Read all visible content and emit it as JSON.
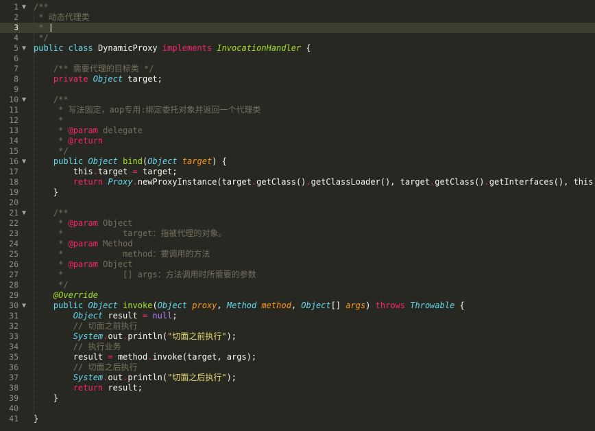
{
  "editor": {
    "current_line": 3,
    "lines": [
      {
        "n": "1",
        "fold": true,
        "tokens": [
          {
            "t": "/**",
            "c": "comment"
          }
        ]
      },
      {
        "n": "2",
        "fold": false,
        "tokens": [
          {
            "t": " * 动态代理类",
            "c": "comment"
          }
        ]
      },
      {
        "n": "3",
        "fold": false,
        "tokens": [
          {
            "t": " * ",
            "c": "comment"
          },
          {
            "t": "|",
            "c": "caret"
          }
        ]
      },
      {
        "n": "4",
        "fold": false,
        "tokens": [
          {
            "t": " */",
            "c": "comment"
          }
        ]
      },
      {
        "n": "5",
        "fold": true,
        "tokens": [
          {
            "t": "public",
            "c": "storage"
          },
          {
            "t": " ",
            "c": "plain"
          },
          {
            "t": "class",
            "c": "storage"
          },
          {
            "t": " DynamicProxy ",
            "c": "plain"
          },
          {
            "t": "implements",
            "c": "keyword"
          },
          {
            "t": " ",
            "c": "plain"
          },
          {
            "t": "InvocationHandler",
            "c": "class"
          },
          {
            "t": " {",
            "c": "plain"
          }
        ]
      },
      {
        "n": "6",
        "fold": false,
        "tokens": []
      },
      {
        "n": "7",
        "fold": false,
        "tokens": [
          {
            "t": "    /** 需要代理的目标类 */",
            "c": "comment"
          }
        ]
      },
      {
        "n": "8",
        "fold": false,
        "tokens": [
          {
            "t": "    ",
            "c": "plain"
          },
          {
            "t": "private",
            "c": "keyword"
          },
          {
            "t": " ",
            "c": "plain"
          },
          {
            "t": "Object",
            "c": "type"
          },
          {
            "t": " target;",
            "c": "plain"
          }
        ]
      },
      {
        "n": "9",
        "fold": false,
        "tokens": []
      },
      {
        "n": "10",
        "fold": true,
        "tokens": [
          {
            "t": "    /**",
            "c": "comment"
          }
        ]
      },
      {
        "n": "11",
        "fold": false,
        "tokens": [
          {
            "t": "     * 写法固定，aop专用:绑定委托对象并返回一个代理类",
            "c": "comment"
          }
        ]
      },
      {
        "n": "12",
        "fold": false,
        "tokens": [
          {
            "t": "     *",
            "c": "comment"
          }
        ]
      },
      {
        "n": "13",
        "fold": false,
        "tokens": [
          {
            "t": "     * ",
            "c": "comment"
          },
          {
            "t": "@param",
            "c": "tag"
          },
          {
            "t": " delegate",
            "c": "comment"
          }
        ]
      },
      {
        "n": "14",
        "fold": false,
        "tokens": [
          {
            "t": "     * ",
            "c": "comment"
          },
          {
            "t": "@return",
            "c": "tag"
          }
        ]
      },
      {
        "n": "15",
        "fold": false,
        "tokens": [
          {
            "t": "     */",
            "c": "comment"
          }
        ]
      },
      {
        "n": "16",
        "fold": true,
        "tokens": [
          {
            "t": "    ",
            "c": "plain"
          },
          {
            "t": "public",
            "c": "storage"
          },
          {
            "t": " ",
            "c": "plain"
          },
          {
            "t": "Object",
            "c": "type"
          },
          {
            "t": " ",
            "c": "plain"
          },
          {
            "t": "bind",
            "c": "func"
          },
          {
            "t": "(",
            "c": "plain"
          },
          {
            "t": "Object",
            "c": "type"
          },
          {
            "t": " ",
            "c": "plain"
          },
          {
            "t": "target",
            "c": "param"
          },
          {
            "t": ") {",
            "c": "plain"
          }
        ]
      },
      {
        "n": "17",
        "fold": false,
        "tokens": [
          {
            "t": "        ",
            "c": "plain"
          },
          {
            "t": "this",
            "c": "plain"
          },
          {
            "t": ".",
            "c": "op"
          },
          {
            "t": "target ",
            "c": "plain"
          },
          {
            "t": "=",
            "c": "op"
          },
          {
            "t": " target;",
            "c": "plain"
          }
        ]
      },
      {
        "n": "18",
        "fold": false,
        "tokens": [
          {
            "t": "        ",
            "c": "plain"
          },
          {
            "t": "return",
            "c": "keyword"
          },
          {
            "t": " ",
            "c": "plain"
          },
          {
            "t": "Proxy",
            "c": "type"
          },
          {
            "t": ".",
            "c": "op"
          },
          {
            "t": "newProxyInstance(target",
            "c": "plain"
          },
          {
            "t": ".",
            "c": "op"
          },
          {
            "t": "getClass()",
            "c": "plain"
          },
          {
            "t": ".",
            "c": "op"
          },
          {
            "t": "getClassLoader(), target",
            "c": "plain"
          },
          {
            "t": ".",
            "c": "op"
          },
          {
            "t": "getClass()",
            "c": "plain"
          },
          {
            "t": ".",
            "c": "op"
          },
          {
            "t": "getInterfaces(), this);",
            "c": "plain"
          }
        ]
      },
      {
        "n": "19",
        "fold": false,
        "tokens": [
          {
            "t": "    }",
            "c": "plain"
          }
        ]
      },
      {
        "n": "20",
        "fold": false,
        "tokens": []
      },
      {
        "n": "21",
        "fold": true,
        "tokens": [
          {
            "t": "    /**",
            "c": "comment"
          }
        ]
      },
      {
        "n": "22",
        "fold": false,
        "tokens": [
          {
            "t": "     * ",
            "c": "comment"
          },
          {
            "t": "@param",
            "c": "tag"
          },
          {
            "t": " Object",
            "c": "comment"
          }
        ]
      },
      {
        "n": "23",
        "fold": false,
        "tokens": [
          {
            "t": "     *            target：指被代理的对象。",
            "c": "comment"
          }
        ]
      },
      {
        "n": "24",
        "fold": false,
        "tokens": [
          {
            "t": "     * ",
            "c": "comment"
          },
          {
            "t": "@param",
            "c": "tag"
          },
          {
            "t": " Method",
            "c": "comment"
          }
        ]
      },
      {
        "n": "25",
        "fold": false,
        "tokens": [
          {
            "t": "     *            method：要调用的方法",
            "c": "comment"
          }
        ]
      },
      {
        "n": "26",
        "fold": false,
        "tokens": [
          {
            "t": "     * ",
            "c": "comment"
          },
          {
            "t": "@param",
            "c": "tag"
          },
          {
            "t": " Object",
            "c": "comment"
          }
        ]
      },
      {
        "n": "27",
        "fold": false,
        "tokens": [
          {
            "t": "     *            [] args：方法调用时所需要的参数",
            "c": "comment"
          }
        ]
      },
      {
        "n": "28",
        "fold": false,
        "tokens": [
          {
            "t": "     */",
            "c": "comment"
          }
        ]
      },
      {
        "n": "29",
        "fold": false,
        "tokens": [
          {
            "t": "    ",
            "c": "plain"
          },
          {
            "t": "@Override",
            "c": "annot"
          }
        ]
      },
      {
        "n": "30",
        "fold": true,
        "tokens": [
          {
            "t": "    ",
            "c": "plain"
          },
          {
            "t": "public",
            "c": "storage"
          },
          {
            "t": " ",
            "c": "plain"
          },
          {
            "t": "Object",
            "c": "type"
          },
          {
            "t": " ",
            "c": "plain"
          },
          {
            "t": "invoke",
            "c": "func"
          },
          {
            "t": "(",
            "c": "plain"
          },
          {
            "t": "Object",
            "c": "type"
          },
          {
            "t": " ",
            "c": "plain"
          },
          {
            "t": "proxy",
            "c": "param"
          },
          {
            "t": ", ",
            "c": "plain"
          },
          {
            "t": "Method",
            "c": "type"
          },
          {
            "t": " ",
            "c": "plain"
          },
          {
            "t": "method",
            "c": "param"
          },
          {
            "t": ", ",
            "c": "plain"
          },
          {
            "t": "Object",
            "c": "type"
          },
          {
            "t": "[] ",
            "c": "plain"
          },
          {
            "t": "args",
            "c": "param"
          },
          {
            "t": ") ",
            "c": "plain"
          },
          {
            "t": "throws",
            "c": "keyword"
          },
          {
            "t": " ",
            "c": "plain"
          },
          {
            "t": "Throwable",
            "c": "type"
          },
          {
            "t": " {",
            "c": "plain"
          }
        ]
      },
      {
        "n": "31",
        "fold": false,
        "tokens": [
          {
            "t": "        ",
            "c": "plain"
          },
          {
            "t": "Object",
            "c": "type"
          },
          {
            "t": " result ",
            "c": "plain"
          },
          {
            "t": "=",
            "c": "op"
          },
          {
            "t": " ",
            "c": "plain"
          },
          {
            "t": "null",
            "c": "const"
          },
          {
            "t": ";",
            "c": "plain"
          }
        ]
      },
      {
        "n": "32",
        "fold": false,
        "tokens": [
          {
            "t": "        // 切面之前执行",
            "c": "comment"
          }
        ]
      },
      {
        "n": "33",
        "fold": false,
        "tokens": [
          {
            "t": "        ",
            "c": "plain"
          },
          {
            "t": "System",
            "c": "type"
          },
          {
            "t": ".",
            "c": "op"
          },
          {
            "t": "out",
            "c": "plain"
          },
          {
            "t": ".",
            "c": "op"
          },
          {
            "t": "println(",
            "c": "plain"
          },
          {
            "t": "\"切面之前执行\"",
            "c": "string"
          },
          {
            "t": ");",
            "c": "plain"
          }
        ]
      },
      {
        "n": "34",
        "fold": false,
        "tokens": [
          {
            "t": "        // 执行业务",
            "c": "comment"
          }
        ]
      },
      {
        "n": "35",
        "fold": false,
        "tokens": [
          {
            "t": "        result ",
            "c": "plain"
          },
          {
            "t": "=",
            "c": "op"
          },
          {
            "t": " method",
            "c": "plain"
          },
          {
            "t": ".",
            "c": "op"
          },
          {
            "t": "invoke(target, args);",
            "c": "plain"
          }
        ]
      },
      {
        "n": "36",
        "fold": false,
        "tokens": [
          {
            "t": "        // 切面之后执行",
            "c": "comment"
          }
        ]
      },
      {
        "n": "37",
        "fold": false,
        "tokens": [
          {
            "t": "        ",
            "c": "plain"
          },
          {
            "t": "System",
            "c": "type"
          },
          {
            "t": ".",
            "c": "op"
          },
          {
            "t": "out",
            "c": "plain"
          },
          {
            "t": ".",
            "c": "op"
          },
          {
            "t": "println(",
            "c": "plain"
          },
          {
            "t": "\"切面之后执行\"",
            "c": "string"
          },
          {
            "t": ");",
            "c": "plain"
          }
        ]
      },
      {
        "n": "38",
        "fold": false,
        "tokens": [
          {
            "t": "        ",
            "c": "plain"
          },
          {
            "t": "return",
            "c": "keyword"
          },
          {
            "t": " result;",
            "c": "plain"
          }
        ]
      },
      {
        "n": "39",
        "fold": false,
        "tokens": [
          {
            "t": "    }",
            "c": "plain"
          }
        ]
      },
      {
        "n": "40",
        "fold": false,
        "tokens": []
      },
      {
        "n": "41",
        "fold": false,
        "tokens": [
          {
            "t": "}",
            "c": "plain"
          }
        ]
      }
    ]
  },
  "colors": {
    "background": "#272822",
    "gutter_text": "#8f908a",
    "current_line": "#3e3d32",
    "comment": "#75715e",
    "keyword": "#f92672",
    "type": "#66d9ef",
    "function": "#a6e22e",
    "parameter": "#fd971f",
    "string": "#e6db74",
    "constant": "#ae81ff"
  }
}
